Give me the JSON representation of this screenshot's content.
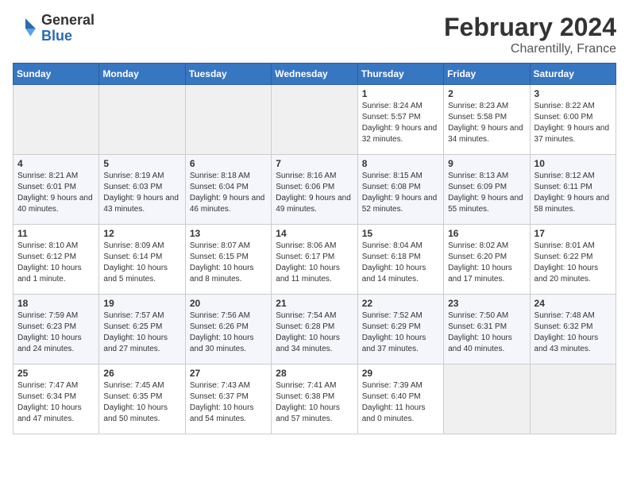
{
  "header": {
    "logo_general": "General",
    "logo_blue": "Blue",
    "title": "February 2024",
    "subtitle": "Charentilly, France"
  },
  "days_of_week": [
    "Sunday",
    "Monday",
    "Tuesday",
    "Wednesday",
    "Thursday",
    "Friday",
    "Saturday"
  ],
  "weeks": [
    [
      {
        "day": "",
        "empty": true
      },
      {
        "day": "",
        "empty": true
      },
      {
        "day": "",
        "empty": true
      },
      {
        "day": "",
        "empty": true
      },
      {
        "day": "1",
        "sunrise": "8:24 AM",
        "sunset": "5:57 PM",
        "daylight": "9 hours and 32 minutes."
      },
      {
        "day": "2",
        "sunrise": "8:23 AM",
        "sunset": "5:58 PM",
        "daylight": "9 hours and 34 minutes."
      },
      {
        "day": "3",
        "sunrise": "8:22 AM",
        "sunset": "6:00 PM",
        "daylight": "9 hours and 37 minutes."
      }
    ],
    [
      {
        "day": "4",
        "sunrise": "8:21 AM",
        "sunset": "6:01 PM",
        "daylight": "9 hours and 40 minutes."
      },
      {
        "day": "5",
        "sunrise": "8:19 AM",
        "sunset": "6:03 PM",
        "daylight": "9 hours and 43 minutes."
      },
      {
        "day": "6",
        "sunrise": "8:18 AM",
        "sunset": "6:04 PM",
        "daylight": "9 hours and 46 minutes."
      },
      {
        "day": "7",
        "sunrise": "8:16 AM",
        "sunset": "6:06 PM",
        "daylight": "9 hours and 49 minutes."
      },
      {
        "day": "8",
        "sunrise": "8:15 AM",
        "sunset": "6:08 PM",
        "daylight": "9 hours and 52 minutes."
      },
      {
        "day": "9",
        "sunrise": "8:13 AM",
        "sunset": "6:09 PM",
        "daylight": "9 hours and 55 minutes."
      },
      {
        "day": "10",
        "sunrise": "8:12 AM",
        "sunset": "6:11 PM",
        "daylight": "9 hours and 58 minutes."
      }
    ],
    [
      {
        "day": "11",
        "sunrise": "8:10 AM",
        "sunset": "6:12 PM",
        "daylight": "10 hours and 1 minute."
      },
      {
        "day": "12",
        "sunrise": "8:09 AM",
        "sunset": "6:14 PM",
        "daylight": "10 hours and 5 minutes."
      },
      {
        "day": "13",
        "sunrise": "8:07 AM",
        "sunset": "6:15 PM",
        "daylight": "10 hours and 8 minutes."
      },
      {
        "day": "14",
        "sunrise": "8:06 AM",
        "sunset": "6:17 PM",
        "daylight": "10 hours and 11 minutes."
      },
      {
        "day": "15",
        "sunrise": "8:04 AM",
        "sunset": "6:18 PM",
        "daylight": "10 hours and 14 minutes."
      },
      {
        "day": "16",
        "sunrise": "8:02 AM",
        "sunset": "6:20 PM",
        "daylight": "10 hours and 17 minutes."
      },
      {
        "day": "17",
        "sunrise": "8:01 AM",
        "sunset": "6:22 PM",
        "daylight": "10 hours and 20 minutes."
      }
    ],
    [
      {
        "day": "18",
        "sunrise": "7:59 AM",
        "sunset": "6:23 PM",
        "daylight": "10 hours and 24 minutes."
      },
      {
        "day": "19",
        "sunrise": "7:57 AM",
        "sunset": "6:25 PM",
        "daylight": "10 hours and 27 minutes."
      },
      {
        "day": "20",
        "sunrise": "7:56 AM",
        "sunset": "6:26 PM",
        "daylight": "10 hours and 30 minutes."
      },
      {
        "day": "21",
        "sunrise": "7:54 AM",
        "sunset": "6:28 PM",
        "daylight": "10 hours and 34 minutes."
      },
      {
        "day": "22",
        "sunrise": "7:52 AM",
        "sunset": "6:29 PM",
        "daylight": "10 hours and 37 minutes."
      },
      {
        "day": "23",
        "sunrise": "7:50 AM",
        "sunset": "6:31 PM",
        "daylight": "10 hours and 40 minutes."
      },
      {
        "day": "24",
        "sunrise": "7:48 AM",
        "sunset": "6:32 PM",
        "daylight": "10 hours and 43 minutes."
      }
    ],
    [
      {
        "day": "25",
        "sunrise": "7:47 AM",
        "sunset": "6:34 PM",
        "daylight": "10 hours and 47 minutes."
      },
      {
        "day": "26",
        "sunrise": "7:45 AM",
        "sunset": "6:35 PM",
        "daylight": "10 hours and 50 minutes."
      },
      {
        "day": "27",
        "sunrise": "7:43 AM",
        "sunset": "6:37 PM",
        "daylight": "10 hours and 54 minutes."
      },
      {
        "day": "28",
        "sunrise": "7:41 AM",
        "sunset": "6:38 PM",
        "daylight": "10 hours and 57 minutes."
      },
      {
        "day": "29",
        "sunrise": "7:39 AM",
        "sunset": "6:40 PM",
        "daylight": "11 hours and 0 minutes."
      },
      {
        "day": "",
        "empty": true
      },
      {
        "day": "",
        "empty": true
      }
    ]
  ]
}
